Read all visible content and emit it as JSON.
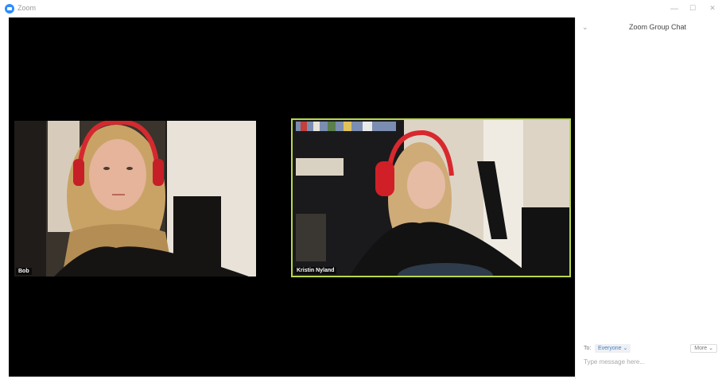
{
  "window": {
    "title": "Zoom",
    "controls": {
      "minimize": "—",
      "maximize": "☐",
      "close": "✕"
    }
  },
  "participants": [
    {
      "name": "Bob",
      "active_speaker": false
    },
    {
      "name": "Kristin Nyland",
      "active_speaker": true
    }
  ],
  "chat": {
    "title": "Zoom Group Chat",
    "collapse_icon": "chevron-down-icon",
    "to_label": "To:",
    "recipient": "Everyone ⌄",
    "more_label": "More ⌄",
    "input_placeholder": "Type message here..."
  },
  "colors": {
    "stage_bg": "#000000",
    "active_speaker_border": "#b9d84a",
    "brand": "#2d8cff"
  }
}
